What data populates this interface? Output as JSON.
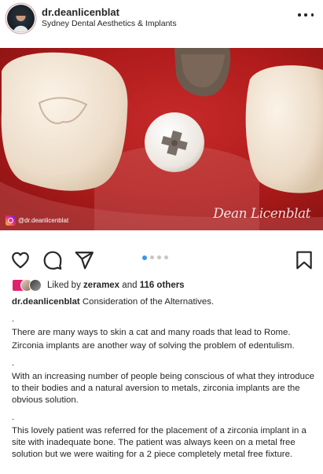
{
  "post": {
    "username": "dr.deanlicenblat",
    "subtitle": "Sydney Dental Aesthetics & Implants",
    "more_icon": "more-horizontal-icon"
  },
  "photo": {
    "handle": "@dr.deanlicenblat",
    "signature": "Dean Licenblat",
    "colors": {
      "gum": "#b61c1c",
      "tooth": "#f2e4d4",
      "implant": "#ece7e0"
    }
  },
  "actions": {
    "icons": [
      "heart-icon",
      "comment-icon",
      "share-icon",
      "bookmark-icon"
    ],
    "carousel_count": 4,
    "carousel_active": 1
  },
  "likes": {
    "prefix": "Liked by",
    "user": "zeramex",
    "connector": "and",
    "others": "116 others"
  },
  "caption": {
    "author": "dr.deanlicenblat",
    "title": "Consideration of the Alternatives.",
    "dot1": ".",
    "para1": "There are many ways to skin a cat and many roads that lead to Rome.",
    "para2": "Zirconia implants are another way of solving the problem of edentulism.",
    "dot2": ".",
    "para3": "With an increasing number of people being conscious of what they introduce to their bodies and a natural aversion to metals, zirconia implants are the obvious solution.",
    "dot3": ".",
    "para4": "This lovely patient was referred for the placement of a zirconia implant in a site with inadequate bone. The patient was always keen on a metal free solution but we were waiting for a 2 piece completely metal free fixture."
  }
}
